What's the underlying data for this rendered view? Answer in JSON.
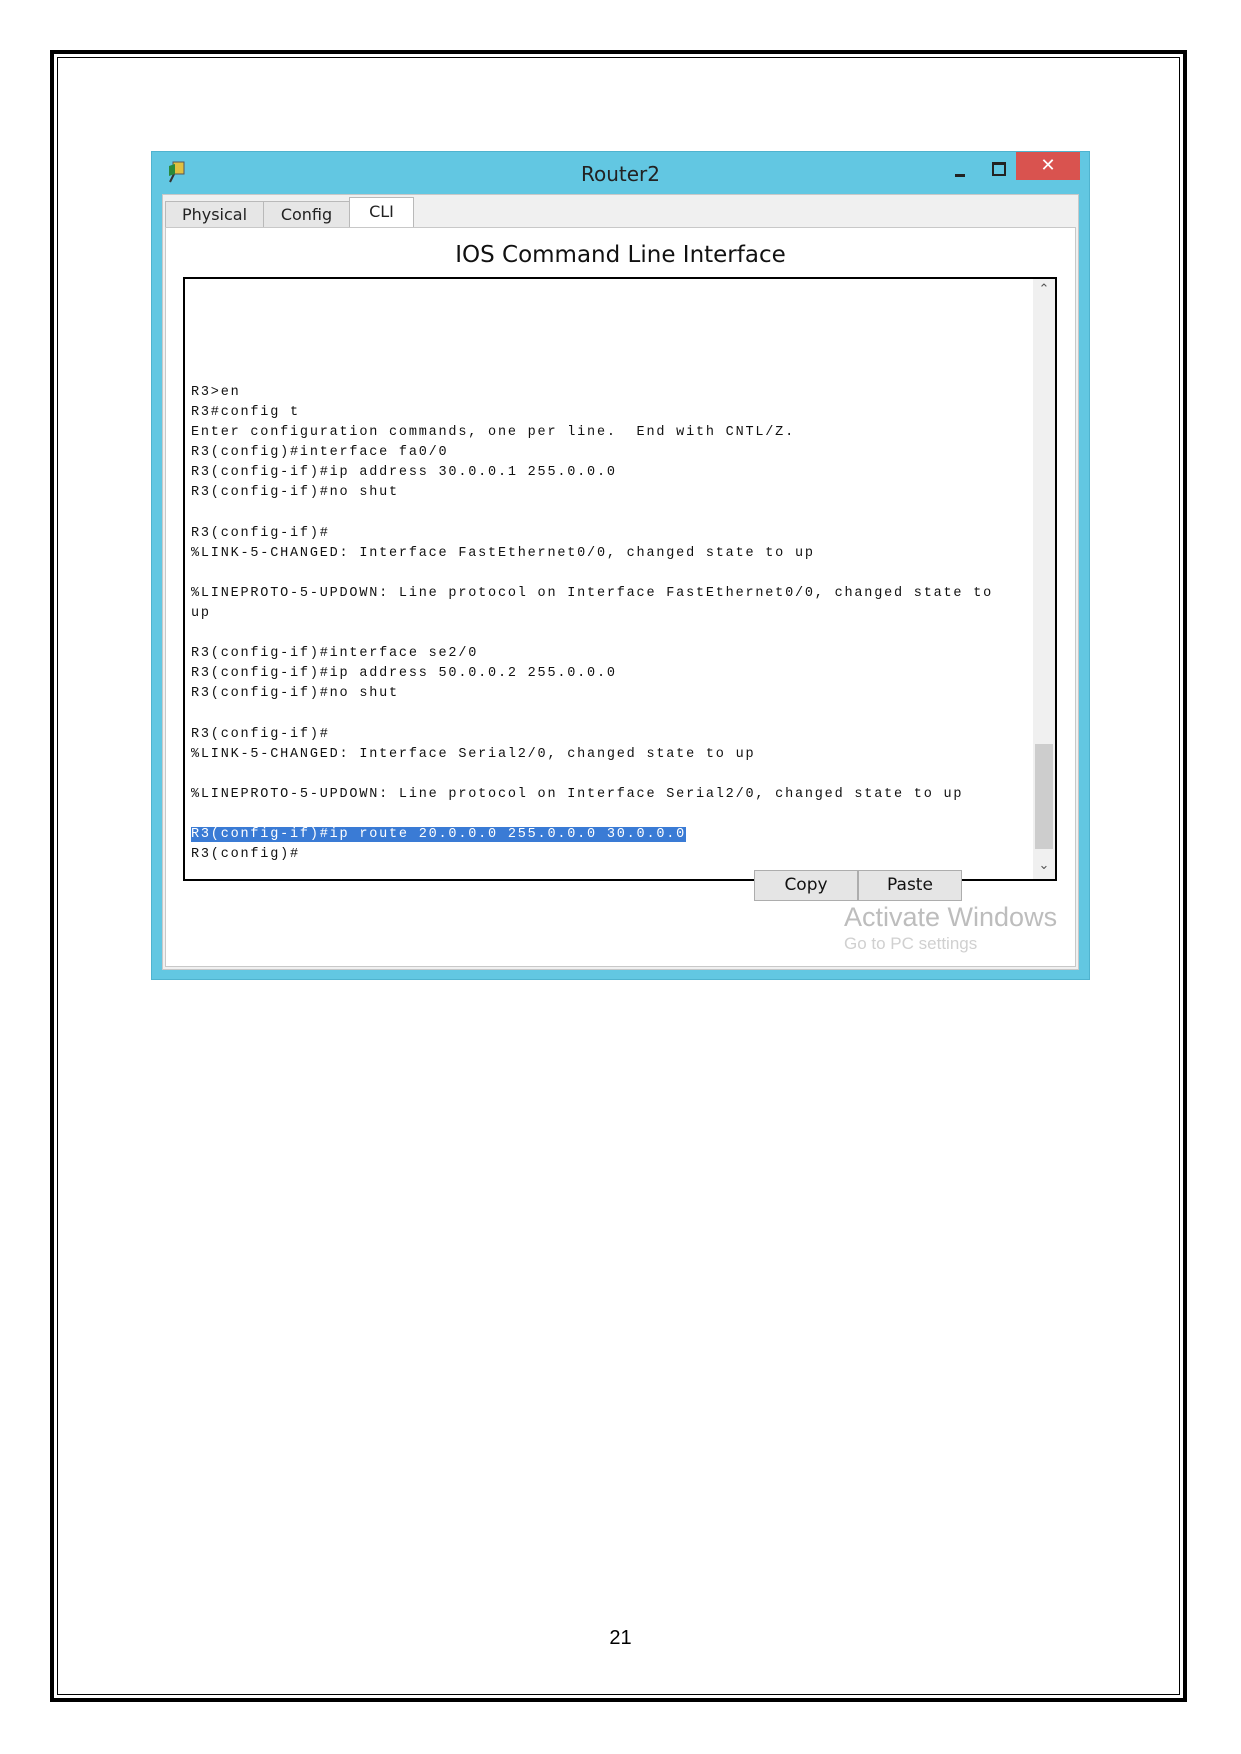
{
  "window": {
    "title": "Router2",
    "close_label": "✕",
    "tabs": [
      {
        "label": "Physical",
        "active": false
      },
      {
        "label": "Config",
        "active": false
      },
      {
        "label": "CLI",
        "active": true
      }
    ],
    "cli_heading": "IOS Command Line Interface",
    "terminal_lines": [
      "R3>en",
      "R3#config t",
      "Enter configuration commands, one per line.  End with CNTL/Z.",
      "R3(config)#interface fa0/0",
      "R3(config-if)#ip address 30.0.0.1 255.0.0.0",
      "R3(config-if)#no shut",
      "",
      "R3(config-if)#",
      "%LINK-5-CHANGED: Interface FastEthernet0/0, changed state to up",
      "",
      "%LINEPROTO-5-UPDOWN: Line protocol on Interface FastEthernet0/0, changed state to",
      "up",
      "",
      "R3(config-if)#interface se2/0",
      "R3(config-if)#ip address 50.0.0.2 255.0.0.0",
      "R3(config-if)#no shut",
      "",
      "R3(config-if)#",
      "%LINK-5-CHANGED: Interface Serial2/0, changed state to up",
      "",
      "%LINEPROTO-5-UPDOWN: Line protocol on Interface Serial2/0, changed state to up",
      ""
    ],
    "highlighted_line": "R3(config-if)#ip route 20.0.0.0 255.0.0.0 30.0.0.0",
    "last_line": "R3(config)#",
    "copy_label": "Copy",
    "paste_label": "Paste",
    "watermark_line1": "Activate Windows",
    "watermark_line2": "Go to PC settings",
    "colors": {
      "titlebar": "#62c7e2",
      "close": "#d9534f",
      "selection": "#3a7bd5"
    }
  },
  "page_number": "21"
}
